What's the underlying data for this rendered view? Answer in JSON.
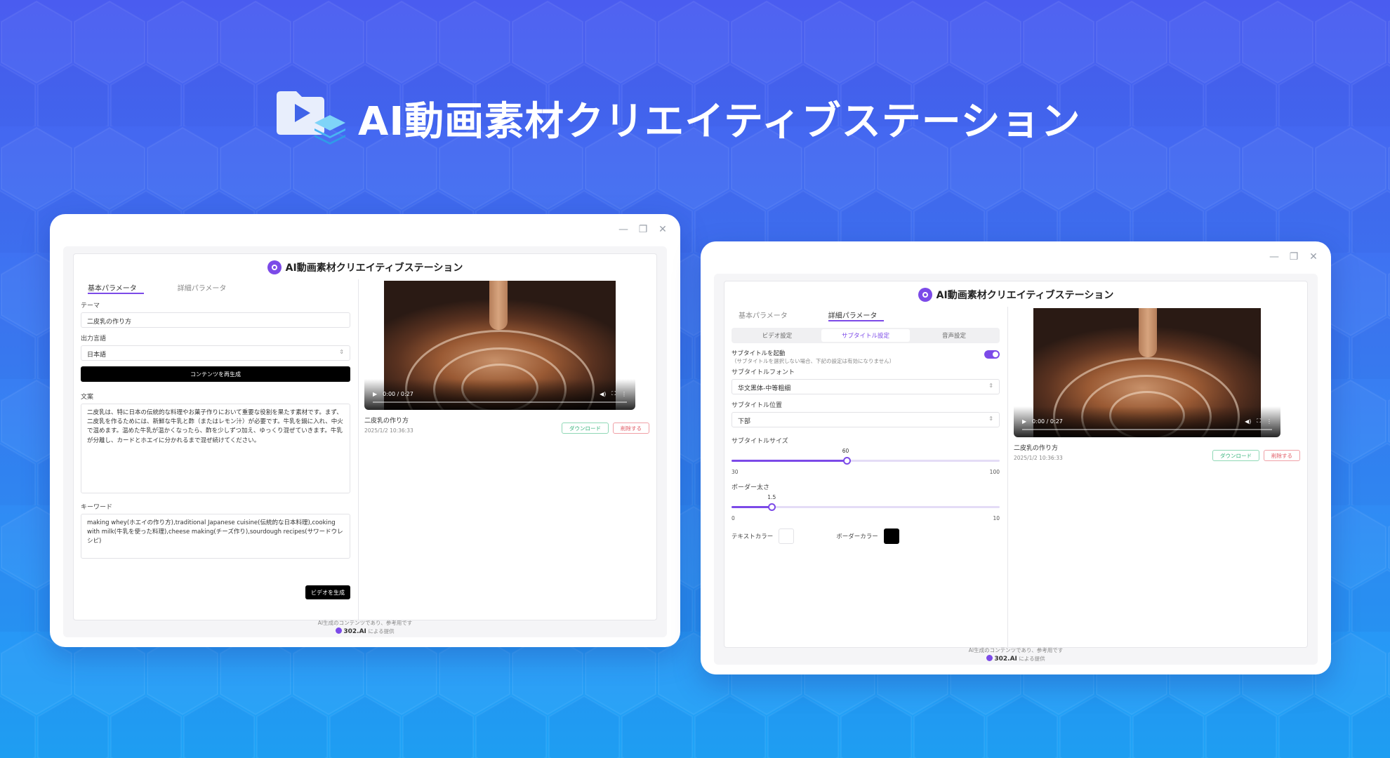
{
  "hero": {
    "title": "AI動画素材クリエイティブステーション"
  },
  "app": {
    "title": "AI動画素材クリエイティブステーション"
  },
  "colors": {
    "accent": "#7c4ae8",
    "download": "#34b27a",
    "delete": "#e05a64",
    "bg_top": "#4a5cf0",
    "bg_bottom": "#1fa4f7"
  },
  "tabs": {
    "basic": "基本パラメータ",
    "detail": "詳細パラメータ"
  },
  "left": {
    "theme_label": "テーマ",
    "theme_value": "二皮乳の作り方",
    "lang_label": "出力言語",
    "lang_value": "日本語",
    "regen_button": "コンテンツを再生成",
    "text_label": "文案",
    "text_value": "二皮乳は、特に日本の伝統的な料理やお菓子作りにおいて重要な役割を果たす素材です。まず、二皮乳を作るためには、新鮮な牛乳と酢（またはレモン汁）が必要です。牛乳を鍋に入れ、中火で温めます。温めた牛乳が温かくなったら、酢を少しずつ加え、ゆっくり混ぜていきます。牛乳が分離し、カードとホエイに分かれるまで混ぜ続けてください。",
    "keywords_label": "キーワード",
    "keywords_value": "making whey(ホエイの作り方),traditional Japanese cuisine(伝統的な日本料理),cooking with milk(牛乳を使った料理),cheese making(チーズ作り),sourdough recipes(サワードウレシピ)",
    "generate_button": "ビデオを生成"
  },
  "video": {
    "time": "0:00 / 0:27",
    "name": "二皮乳の作り方",
    "date": "2025/1/2 10:36:33",
    "download": "ダウンロード",
    "delete": "削除する",
    "progress": 0
  },
  "right": {
    "segments": [
      "ビデオ設定",
      "サブタイトル設定",
      "音声設定"
    ],
    "subtitle_enable": "サブタイトルを起動",
    "subtitle_note": "（サブタイトルを選択しない場合、下記の設定は有効になりません）",
    "subtitle_enabled": true,
    "font_label": "サブタイトルフォント",
    "font_value": "华文黑体-中等粗细",
    "pos_label": "サブタイトル位置",
    "pos_value": "下部",
    "size_label": "サブタイトルサイズ",
    "size_value": "60",
    "size_min": "30",
    "size_max": "100",
    "border_label": "ボーダー太さ",
    "border_value": "1.5",
    "border_min": "0",
    "border_max": "10",
    "text_color_label": "テキストカラー",
    "text_color": "#ffffff",
    "border_color_label": "ボーダーカラー",
    "border_color": "#000000"
  },
  "footer": {
    "note": "AI生成のコンテンツであり、参考用です",
    "brand": "302.AI",
    "provided": "による提供"
  }
}
